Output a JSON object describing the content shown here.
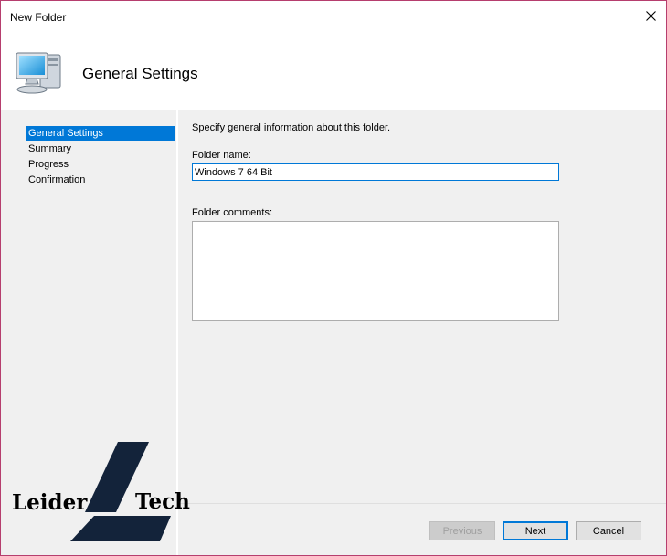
{
  "window": {
    "title": "New Folder"
  },
  "header": {
    "title": "General Settings"
  },
  "nav": {
    "items": [
      {
        "label": "General Settings",
        "active": true
      },
      {
        "label": "Summary"
      },
      {
        "label": "Progress"
      },
      {
        "label": "Confirmation"
      }
    ]
  },
  "form": {
    "description": "Specify general information about this folder.",
    "folder_name_label": "Folder name:",
    "folder_name_value": "Windows 7 64 Bit",
    "folder_comments_label": "Folder comments:",
    "folder_comments_value": ""
  },
  "buttons": {
    "previous": "Previous",
    "next": "Next",
    "cancel": "Cancel"
  },
  "watermark": {
    "left": "Leider",
    "right": "Tech"
  },
  "colors": {
    "accent": "#0078d7",
    "border": "#b63e6e",
    "logo": "#13233a"
  },
  "icons": {
    "close": "close-icon",
    "header": "computer-icon"
  }
}
